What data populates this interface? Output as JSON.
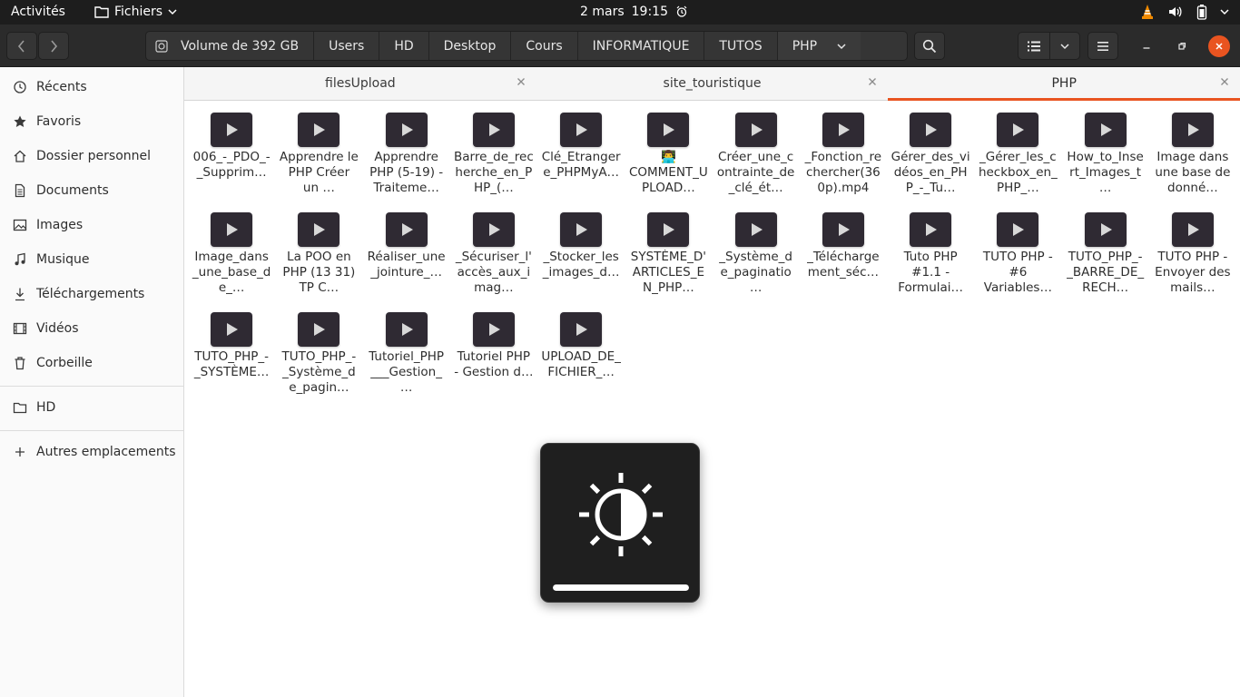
{
  "topbar": {
    "activities": "Activités",
    "app_name": "Fichiers",
    "date": "2 mars",
    "time": "19:15"
  },
  "pathbar": {
    "crumbs": [
      "Volume de 392 GB",
      "Users",
      "HD",
      "Desktop",
      "Cours",
      "INFORMATIQUE",
      "TUTOS",
      "PHP"
    ]
  },
  "sidebar": {
    "items": [
      {
        "label": "Récents",
        "icon": "clock-icon"
      },
      {
        "label": "Favoris",
        "icon": "star-icon"
      },
      {
        "label": "Dossier personnel",
        "icon": "home-icon"
      },
      {
        "label": "Documents",
        "icon": "document-icon"
      },
      {
        "label": "Images",
        "icon": "image-icon"
      },
      {
        "label": "Musique",
        "icon": "music-icon"
      },
      {
        "label": "Téléchargements",
        "icon": "download-icon"
      },
      {
        "label": "Vidéos",
        "icon": "video-icon"
      },
      {
        "label": "Corbeille",
        "icon": "trash-icon"
      }
    ],
    "drives": [
      {
        "label": "HD",
        "icon": "folder-icon"
      }
    ],
    "other": {
      "label": "Autres emplacements",
      "icon": "plus-icon"
    }
  },
  "tabs": [
    {
      "label": "filesUpload",
      "active": false
    },
    {
      "label": "site_touristique",
      "active": false
    },
    {
      "label": "PHP",
      "active": true
    }
  ],
  "files": [
    "006_-_PDO_-_Supprim…",
    "Apprendre le PHP Créer un …",
    "Apprendre PHP (5-19) - Traiteme…",
    "Barre_de_recherche_en_PHP_(…",
    "Clé_Etrangere_PHPMyA…",
    "👨‍💻 COMMENT_UPLOAD…",
    "Créer_une_contrainte_de_clé_ét…",
    "_Fonction_rechercher(360p).mp4",
    "Gérer_des_vidéos_en_PHP_-_Tu…",
    "_Gérer_les_checkbox_en_PHP_…",
    "How_to_Insert_Images_t…",
    "Image dans une base de donné…",
    "Image_dans_une_base_de_…",
    "La POO en PHP (13 31)  TP  C…",
    "Réaliser_une_jointure_…",
    "_Sécuriser_l'accès_aux_imag…",
    "_Stocker_les_images_d…",
    "SYSTÈME_D'ARTICLES_EN_PHP…",
    "_Système_de_paginatio…",
    "_Télécharge ment_séc…",
    "Tuto PHP #1.1 - Formulai…",
    "TUTO PHP - #6 Variables…",
    "TUTO_PHP_-_BARRE_DE_RECH…",
    "TUTO PHP - Envoyer des mails…",
    "TUTO_PHP_-_SYSTÈME…",
    "TUTO_PHP_-_Système_de_pagin…",
    "Tutoriel_PHP___Gestion_…",
    "Tutoriel PHP - Gestion d…",
    "UPLOAD_DE_FICHIER_…"
  ],
  "osd": {
    "icon": "brightness-icon",
    "level": 1.0
  },
  "colors": {
    "accent": "#e95420",
    "close_button": "#e95420",
    "dark_bar": "#1d1d1d",
    "header": "#2b2b2b"
  }
}
